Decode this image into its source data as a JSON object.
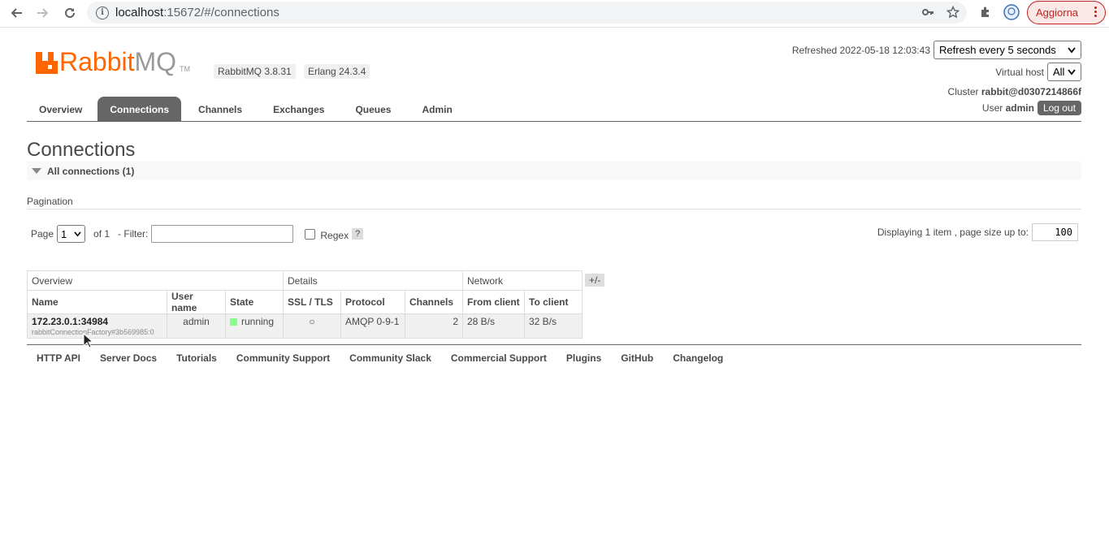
{
  "browser": {
    "url_host": "localhost",
    "url_rest": ":15672/#/connections",
    "update_label": "Aggiorna"
  },
  "header": {
    "logo_rabbit": "Rabbit",
    "logo_mq": "MQ",
    "logo_tm": "TM",
    "version_rabbit": "RabbitMQ 3.8.31",
    "version_erlang": "Erlang 24.3.4",
    "refreshed": "Refreshed 2022-05-18 12:03:43",
    "refresh_select": "Refresh every 5 seconds",
    "vhost_label": "Virtual host",
    "vhost_select": "All",
    "cluster_label": "Cluster",
    "cluster_name": "rabbit@d0307214866f",
    "user_label": "User",
    "user_name": "admin",
    "logout": "Log out"
  },
  "tabs": [
    {
      "label": "Overview"
    },
    {
      "label": "Connections"
    },
    {
      "label": "Channels"
    },
    {
      "label": "Exchanges"
    },
    {
      "label": "Queues"
    },
    {
      "label": "Admin"
    }
  ],
  "main": {
    "title": "Connections",
    "section": "All connections (1)",
    "pagination_label": "Pagination",
    "page_label": "Page",
    "page_value": "1",
    "of_label": "of 1",
    "filter_label": "- Filter:",
    "regex_label": "Regex",
    "help": "?",
    "displaying": "Displaying 1 item , page size up to:",
    "page_size": "100",
    "plusminus": "+/-"
  },
  "table": {
    "groups": [
      "Overview",
      "Details",
      "Network"
    ],
    "columns": [
      "Name",
      "User name",
      "State",
      "SSL / TLS",
      "Protocol",
      "Channels",
      "From client",
      "To client"
    ],
    "rows": [
      {
        "name": "172.23.0.1:34984",
        "sub": "rabbitConnectionFactory#3b569985:0",
        "user": "admin",
        "state": "running",
        "ssl": "○",
        "protocol": "AMQP 0-9-1",
        "channels": "2",
        "from_client": "28 B/s",
        "to_client": "32 B/s"
      }
    ]
  },
  "footer": [
    "HTTP API",
    "Server Docs",
    "Tutorials",
    "Community Support",
    "Community Slack",
    "Commercial Support",
    "Plugins",
    "GitHub",
    "Changelog"
  ]
}
